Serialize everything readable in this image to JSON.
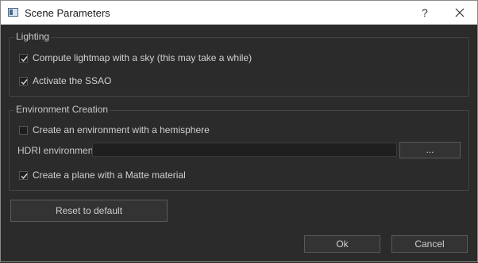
{
  "window": {
    "title": "Scene Parameters",
    "help_glyph": "?"
  },
  "lighting": {
    "title": "Lighting",
    "compute_lightmap_label": "Compute lightmap with a sky (this may take a while)",
    "compute_lightmap_checked": true,
    "ssao_label": "Activate the SSAO",
    "ssao_checked": true
  },
  "environment": {
    "title": "Environment Creation",
    "hemisphere_label": "Create an environment with a hemisphere",
    "hemisphere_checked": false,
    "hdri_label": "HDRI environment",
    "hdri_value": "",
    "browse_label": "...",
    "matte_plane_label": "Create a plane with a Matte material",
    "matte_plane_checked": true
  },
  "buttons": {
    "reset_label": "Reset to default",
    "ok_label": "Ok",
    "cancel_label": "Cancel"
  }
}
